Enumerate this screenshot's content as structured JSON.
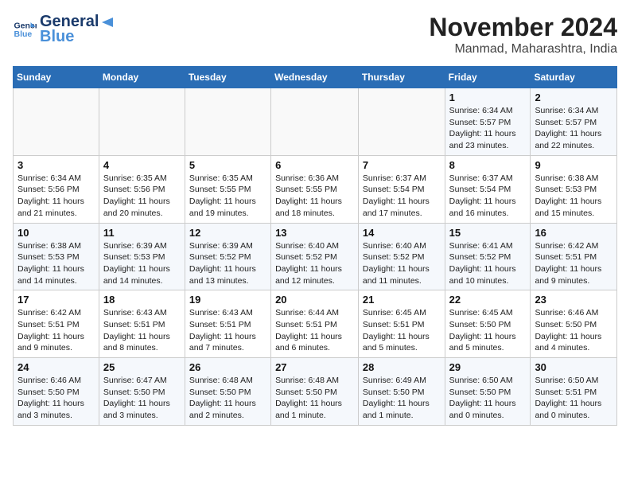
{
  "logo": {
    "line1": "General",
    "line2": "Blue"
  },
  "title": "November 2024",
  "location": "Manmad, Maharashtra, India",
  "headers": [
    "Sunday",
    "Monday",
    "Tuesday",
    "Wednesday",
    "Thursday",
    "Friday",
    "Saturday"
  ],
  "weeks": [
    [
      {
        "day": "",
        "info": ""
      },
      {
        "day": "",
        "info": ""
      },
      {
        "day": "",
        "info": ""
      },
      {
        "day": "",
        "info": ""
      },
      {
        "day": "",
        "info": ""
      },
      {
        "day": "1",
        "info": "Sunrise: 6:34 AM\nSunset: 5:57 PM\nDaylight: 11 hours\nand 23 minutes."
      },
      {
        "day": "2",
        "info": "Sunrise: 6:34 AM\nSunset: 5:57 PM\nDaylight: 11 hours\nand 22 minutes."
      }
    ],
    [
      {
        "day": "3",
        "info": "Sunrise: 6:34 AM\nSunset: 5:56 PM\nDaylight: 11 hours\nand 21 minutes."
      },
      {
        "day": "4",
        "info": "Sunrise: 6:35 AM\nSunset: 5:56 PM\nDaylight: 11 hours\nand 20 minutes."
      },
      {
        "day": "5",
        "info": "Sunrise: 6:35 AM\nSunset: 5:55 PM\nDaylight: 11 hours\nand 19 minutes."
      },
      {
        "day": "6",
        "info": "Sunrise: 6:36 AM\nSunset: 5:55 PM\nDaylight: 11 hours\nand 18 minutes."
      },
      {
        "day": "7",
        "info": "Sunrise: 6:37 AM\nSunset: 5:54 PM\nDaylight: 11 hours\nand 17 minutes."
      },
      {
        "day": "8",
        "info": "Sunrise: 6:37 AM\nSunset: 5:54 PM\nDaylight: 11 hours\nand 16 minutes."
      },
      {
        "day": "9",
        "info": "Sunrise: 6:38 AM\nSunset: 5:53 PM\nDaylight: 11 hours\nand 15 minutes."
      }
    ],
    [
      {
        "day": "10",
        "info": "Sunrise: 6:38 AM\nSunset: 5:53 PM\nDaylight: 11 hours\nand 14 minutes."
      },
      {
        "day": "11",
        "info": "Sunrise: 6:39 AM\nSunset: 5:53 PM\nDaylight: 11 hours\nand 14 minutes."
      },
      {
        "day": "12",
        "info": "Sunrise: 6:39 AM\nSunset: 5:52 PM\nDaylight: 11 hours\nand 13 minutes."
      },
      {
        "day": "13",
        "info": "Sunrise: 6:40 AM\nSunset: 5:52 PM\nDaylight: 11 hours\nand 12 minutes."
      },
      {
        "day": "14",
        "info": "Sunrise: 6:40 AM\nSunset: 5:52 PM\nDaylight: 11 hours\nand 11 minutes."
      },
      {
        "day": "15",
        "info": "Sunrise: 6:41 AM\nSunset: 5:52 PM\nDaylight: 11 hours\nand 10 minutes."
      },
      {
        "day": "16",
        "info": "Sunrise: 6:42 AM\nSunset: 5:51 PM\nDaylight: 11 hours\nand 9 minutes."
      }
    ],
    [
      {
        "day": "17",
        "info": "Sunrise: 6:42 AM\nSunset: 5:51 PM\nDaylight: 11 hours\nand 9 minutes."
      },
      {
        "day": "18",
        "info": "Sunrise: 6:43 AM\nSunset: 5:51 PM\nDaylight: 11 hours\nand 8 minutes."
      },
      {
        "day": "19",
        "info": "Sunrise: 6:43 AM\nSunset: 5:51 PM\nDaylight: 11 hours\nand 7 minutes."
      },
      {
        "day": "20",
        "info": "Sunrise: 6:44 AM\nSunset: 5:51 PM\nDaylight: 11 hours\nand 6 minutes."
      },
      {
        "day": "21",
        "info": "Sunrise: 6:45 AM\nSunset: 5:51 PM\nDaylight: 11 hours\nand 5 minutes."
      },
      {
        "day": "22",
        "info": "Sunrise: 6:45 AM\nSunset: 5:50 PM\nDaylight: 11 hours\nand 5 minutes."
      },
      {
        "day": "23",
        "info": "Sunrise: 6:46 AM\nSunset: 5:50 PM\nDaylight: 11 hours\nand 4 minutes."
      }
    ],
    [
      {
        "day": "24",
        "info": "Sunrise: 6:46 AM\nSunset: 5:50 PM\nDaylight: 11 hours\nand 3 minutes."
      },
      {
        "day": "25",
        "info": "Sunrise: 6:47 AM\nSunset: 5:50 PM\nDaylight: 11 hours\nand 3 minutes."
      },
      {
        "day": "26",
        "info": "Sunrise: 6:48 AM\nSunset: 5:50 PM\nDaylight: 11 hours\nand 2 minutes."
      },
      {
        "day": "27",
        "info": "Sunrise: 6:48 AM\nSunset: 5:50 PM\nDaylight: 11 hours\nand 1 minute."
      },
      {
        "day": "28",
        "info": "Sunrise: 6:49 AM\nSunset: 5:50 PM\nDaylight: 11 hours\nand 1 minute."
      },
      {
        "day": "29",
        "info": "Sunrise: 6:50 AM\nSunset: 5:50 PM\nDaylight: 11 hours\nand 0 minutes."
      },
      {
        "day": "30",
        "info": "Sunrise: 6:50 AM\nSunset: 5:51 PM\nDaylight: 11 hours\nand 0 minutes."
      }
    ]
  ]
}
